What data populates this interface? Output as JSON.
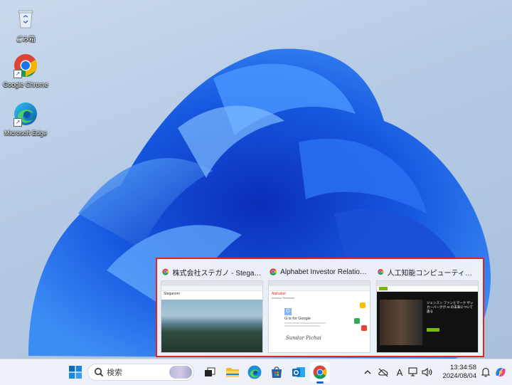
{
  "desktop": {
    "icons": [
      {
        "label": "ごみ箱",
        "icon": "recycle-bin-icon"
      },
      {
        "label": "Google Chrome",
        "icon": "chrome-icon"
      },
      {
        "label": "Microsoft Edge",
        "icon": "edge-icon"
      }
    ]
  },
  "taskbar_preview": {
    "windows": [
      {
        "title": "株式会社ステガノ - Steganom - G...",
        "icon": "chrome-icon",
        "preview_heading": "Steganom"
      },
      {
        "title": "Alphabet Investor Relations - G...",
        "icon": "chrome-icon",
        "preview_heading": "Alphabet",
        "preview_sub": "Investor Relations",
        "preview_text": "G is for Google",
        "preview_signature": "Sundar Pichai"
      },
      {
        "title": "人工知能コンピューティングで世界を...",
        "icon": "chrome-icon",
        "preview_heading": "ジェンスン ファンとマーク ザッカーバーグが AI の未来について語る"
      }
    ]
  },
  "taskbar": {
    "search_placeholder": "検索",
    "apps": [
      "start-icon",
      "search-icon",
      "task-view-icon",
      "file-explorer-icon",
      "edge-icon",
      "microsoft-store-icon",
      "outlook-icon",
      "chrome-icon"
    ],
    "tray": {
      "ime": "A",
      "time": "13:34:58",
      "date": "2024/08/04"
    }
  },
  "colors": {
    "highlight_border": "#e0261d",
    "accent": "#1a5fd0"
  }
}
